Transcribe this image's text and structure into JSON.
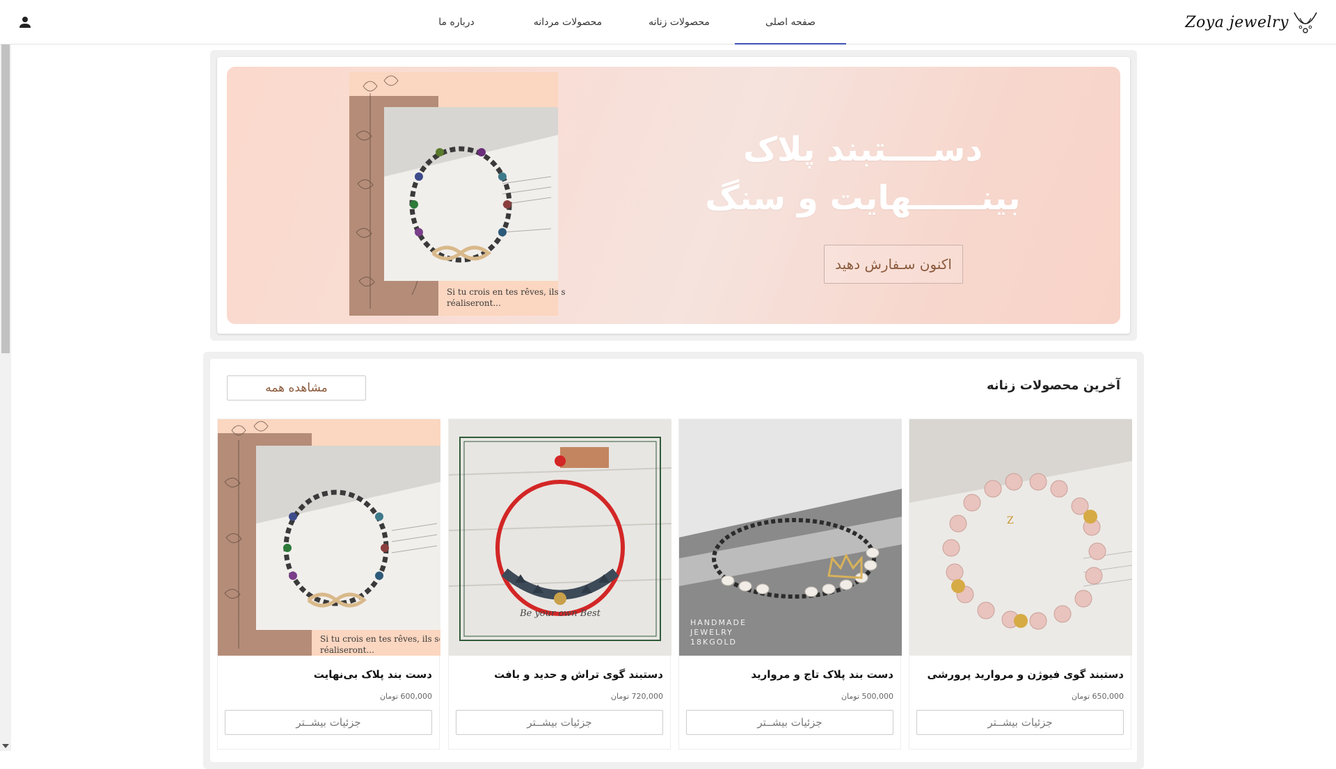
{
  "header": {
    "brand": "Zoya jewelry",
    "nav": [
      {
        "label": "صفحه اصلی",
        "active": true
      },
      {
        "label": "محصولات زنانه",
        "active": false
      },
      {
        "label": "محصولات مردانه",
        "active": false
      },
      {
        "label": "درباره ما",
        "active": false
      }
    ],
    "icons": {
      "brand_icon": "necklace-icon",
      "user_icon": "person-icon"
    },
    "accent_color": "#3f51b5"
  },
  "hero": {
    "title_line1": "دســــتبند پلاک",
    "title_line2": "بینــــــهایت و سنگ",
    "cta": "اکنون سـفارش دهید",
    "image_caption_line1": "Si tu crois en tes rêves, ils se",
    "image_caption_line2": "réaliseront...",
    "cta_color": "#8b5a3c"
  },
  "section": {
    "title": "آخرین محصولات زنانه",
    "view_all": "مشاهده همه"
  },
  "products": [
    {
      "name": "دستبند گوی فیوژن و مروارید پرورشی",
      "price": "650,000 تومان",
      "button": "جزئیات بیشــتر"
    },
    {
      "name": "دست بند پلاک تاج و مروارید",
      "price": "500,000 تومان",
      "button": "جزئیات بیشــتر",
      "watermark": "HANDMADE JEWELRY 18KGOLD"
    },
    {
      "name": "دستبند گوی تراش و حدید و بافت",
      "price": "720,000 تومان",
      "button": "جزئیات بیشــتر",
      "watermark": "Be your own Best"
    },
    {
      "name": "دست بند پلاک بی‌نهایت",
      "price": "600,000 تومان",
      "button": "جزئیات بیشــتر",
      "caption_line1": "Si tu crois en tes rêves, ils se",
      "caption_line2": "réaliseront..."
    }
  ]
}
